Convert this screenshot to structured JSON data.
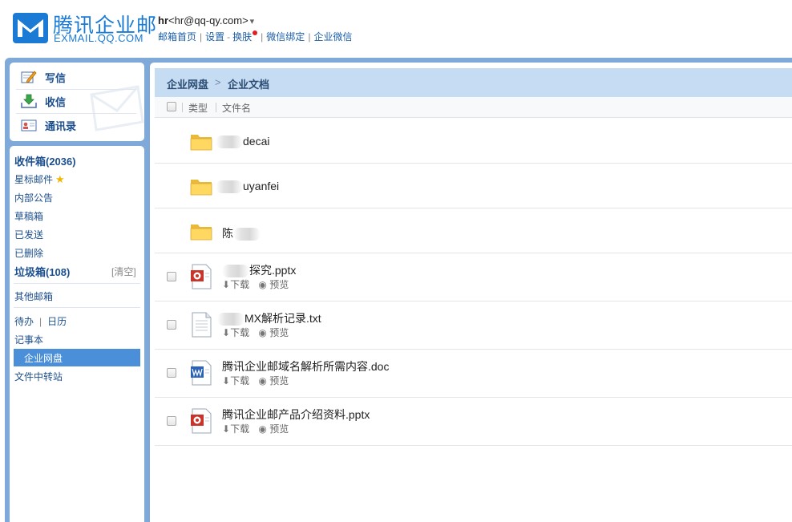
{
  "brand": {
    "name_cn": "腾讯企业邮",
    "name_en": "EXMAIL.QQ.COM"
  },
  "user": {
    "name": "hr",
    "email": "<hr@qq-qy.com>",
    "caret": "▾"
  },
  "header_links": [
    "邮箱首页",
    "设置",
    "换肤",
    "微信绑定",
    "企业微信"
  ],
  "header_link_seps": [
    "|",
    "-",
    "|",
    "|"
  ],
  "primary_nav": [
    {
      "label": "写信",
      "icon": "compose-icon"
    },
    {
      "label": "收信",
      "icon": "inbox-download-icon"
    },
    {
      "label": "通讯录",
      "icon": "contacts-card-icon"
    }
  ],
  "folders": {
    "inbox": "收件箱(2036)",
    "starred": "星标邮件",
    "announcements": "内部公告",
    "drafts": "草稿箱",
    "sent": "已发送",
    "deleted": "已删除",
    "spam": "垃圾箱(108)",
    "clear": "[清空]",
    "other_mailboxes": "其他邮箱",
    "todo": "待办",
    "calendar_sep": "|",
    "calendar": "日历",
    "notes": "记事本",
    "enterprise_drive": "企业网盘",
    "file_transfer": "文件中转站"
  },
  "breadcrumb": {
    "root": "企业网盘",
    "separator": ">",
    "current": "企业文档"
  },
  "columns": {
    "type": "类型",
    "filename": "文件名"
  },
  "files": [
    {
      "kind": "folder",
      "name_suffix": "decai"
    },
    {
      "kind": "folder",
      "name_suffix": "uyanfei"
    },
    {
      "kind": "folder",
      "name_prefix": "陈"
    },
    {
      "kind": "pptx",
      "name_suffix": "探究.pptx",
      "download": "下载",
      "preview": "预览"
    },
    {
      "kind": "txt",
      "name_suffix": "MX解析记录.txt",
      "download": "下载",
      "preview": "预览"
    },
    {
      "kind": "doc",
      "name": "腾讯企业邮域名解析所需内容.doc",
      "download": "下载",
      "preview": "预览"
    },
    {
      "kind": "pptx",
      "name": "腾讯企业邮产品介绍资料.pptx",
      "download": "下载",
      "preview": "预览"
    }
  ],
  "colors": {
    "brand_blue": "#1a7ad4",
    "frame_blue": "#7fa9d9",
    "path_bar": "#c6dcf2",
    "active_nav": "#4a8fd8",
    "link_blue": "#1c5fa8"
  }
}
